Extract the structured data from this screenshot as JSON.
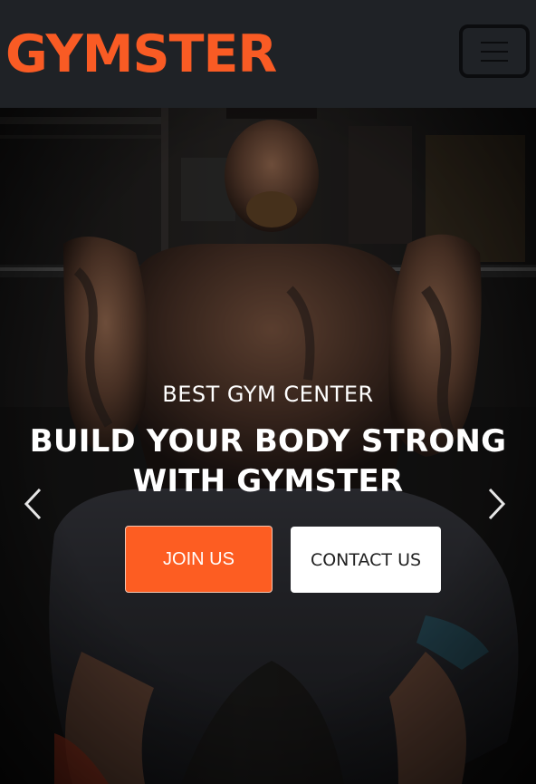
{
  "brand": {
    "name": "GYMSTER",
    "color": "#f95b24"
  },
  "navbar": {
    "toggler_icon": "hamburger-icon"
  },
  "hero": {
    "subtitle": "BEST GYM CENTER",
    "title_line1": "BUILD YOUR BODY STRONG",
    "title_line2": "WITH GYMSTER",
    "primary_button": "JOIN US",
    "secondary_button": "CONTACT US",
    "accent_color": "#fd5d22",
    "prev_icon": "chevron-left-icon",
    "next_icon": "chevron-right-icon"
  }
}
